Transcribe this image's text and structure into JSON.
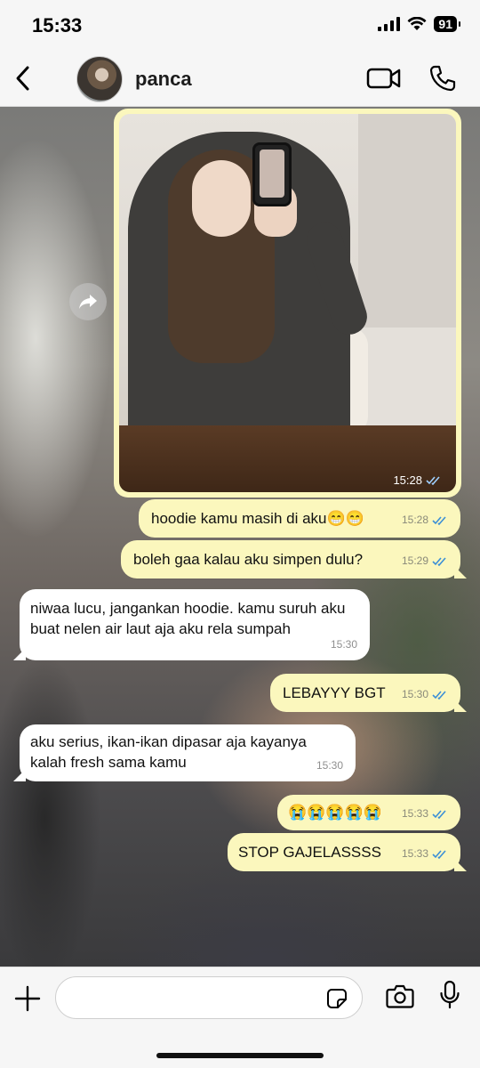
{
  "status_bar": {
    "time": "15:33",
    "battery": "91"
  },
  "header": {
    "contact_name": "panca"
  },
  "photo_message": {
    "time": "15:28",
    "status": "read"
  },
  "messages": [
    {
      "direction": "out",
      "text": "hoodie kamu masih di aku😁😁",
      "time": "15:28",
      "status": "read"
    },
    {
      "direction": "out",
      "text": "boleh gaa kalau aku simpen dulu?",
      "time": "15:29",
      "status": "read"
    },
    {
      "direction": "in",
      "text": "niwaa lucu, jangankan hoodie. kamu suruh aku buat nelen air laut aja aku rela sumpah",
      "time": "15:30"
    },
    {
      "direction": "out",
      "text": "LEBAYYY BGT",
      "time": "15:30",
      "status": "read"
    },
    {
      "direction": "in",
      "text": "aku serius, ikan-ikan dipasar aja kayanya kalah fresh sama kamu",
      "time": "15:30"
    },
    {
      "direction": "out",
      "text": "😭😭😭😭😭",
      "time": "15:33",
      "status": "read"
    },
    {
      "direction": "out",
      "text": "STOP GAJELASSSS",
      "time": "15:33",
      "status": "read"
    }
  ],
  "input": {
    "value": "",
    "placeholder": ""
  },
  "colors": {
    "outgoing_bubble": "#fbf7bd",
    "incoming_bubble": "#ffffff",
    "read_ticks": "#3b8fd6"
  },
  "icons": [
    "back-icon",
    "video-call-icon",
    "phone-icon",
    "forward-icon",
    "plus-icon",
    "sticker-icon",
    "camera-icon",
    "microphone-icon"
  ]
}
